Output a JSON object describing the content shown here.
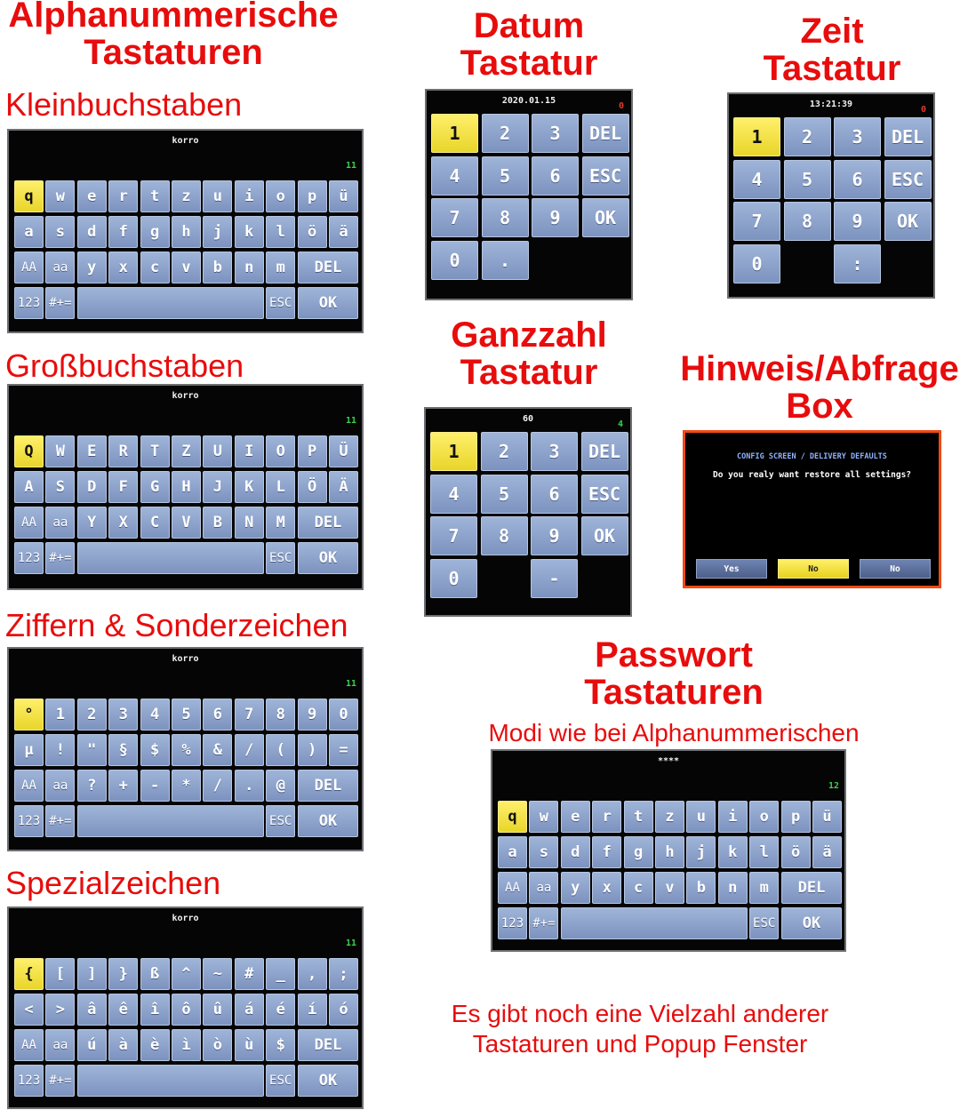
{
  "colors": {
    "heading": "#e80c0c",
    "key": "#8ea4cc",
    "key_selected": "#f2e23f",
    "screen": "#050505",
    "counter": "#39d34a",
    "counter_red": "#e63a2e",
    "dialog_border": "#f04a14"
  },
  "headings": {
    "alpha_line1": "Alphanummerische",
    "alpha_line2": "Tastaturen",
    "datum_line1": "Datum",
    "datum_line2": "Tastatur",
    "zeit_line1": "Zeit",
    "zeit_line2": "Tastatur",
    "ganz_line1": "Ganzzahl",
    "ganz_line2": "Tastatur",
    "hinweis_line1": "Hinweis/Abfrage",
    "hinweis_line2": "Box",
    "pass_line1": "Passwort",
    "pass_line2": "Tastaturen",
    "pass_sub": "Modi wie bei Alphanummerischen"
  },
  "labels": {
    "lower": "Kleinbuchstaben",
    "upper": "Großbuchstaben",
    "digits": "Ziffern & Sonderzeichen",
    "special": "Spezialzeichen"
  },
  "note": {
    "line1": "Es gibt noch eine Vielzahl anderer",
    "line2": "Tastaturen und Popup Fenster"
  },
  "keyboards": {
    "lower": {
      "field": "korro",
      "count": "11",
      "row1": [
        "q",
        "w",
        "e",
        "r",
        "t",
        "z",
        "u",
        "i",
        "o",
        "p",
        "ü"
      ],
      "row2": [
        "a",
        "s",
        "d",
        "f",
        "g",
        "h",
        "j",
        "k",
        "l",
        "ö",
        "ä"
      ],
      "row3": [
        "AA",
        "aa",
        "y",
        "x",
        "c",
        "v",
        "b",
        "n",
        "m",
        "DEL"
      ],
      "row4": [
        "123",
        "#+=",
        "",
        "ESC",
        "OK"
      ]
    },
    "upper": {
      "field": "korro",
      "count": "11",
      "row1": [
        "Q",
        "W",
        "E",
        "R",
        "T",
        "Z",
        "U",
        "I",
        "O",
        "P",
        "Ü"
      ],
      "row2": [
        "A",
        "S",
        "D",
        "F",
        "G",
        "H",
        "J",
        "K",
        "L",
        "Ö",
        "Ä"
      ],
      "row3": [
        "AA",
        "aa",
        "Y",
        "X",
        "C",
        "V",
        "B",
        "N",
        "M",
        "DEL"
      ],
      "row4": [
        "123",
        "#+=",
        "",
        "ESC",
        "OK"
      ]
    },
    "digits": {
      "field": "korro",
      "count": "11",
      "row1": [
        "°",
        "1",
        "2",
        "3",
        "4",
        "5",
        "6",
        "7",
        "8",
        "9",
        "0"
      ],
      "row2": [
        "µ",
        "!",
        "\"",
        "§",
        "$",
        "%",
        "&",
        "/",
        "(",
        ")",
        "="
      ],
      "row3": [
        "AA",
        "aa",
        "?",
        "+",
        "-",
        "*",
        "/",
        ".",
        "@",
        "DEL"
      ],
      "row4": [
        "123",
        "#+=",
        "",
        "ESC",
        "OK"
      ]
    },
    "special": {
      "field": "korro",
      "count": "11",
      "row1": [
        "{",
        "[",
        "]",
        "}",
        "ß",
        "^",
        "~",
        "#",
        "_",
        ",",
        ";"
      ],
      "row2": [
        "<",
        ">",
        "â",
        "ê",
        "î",
        "ô",
        "û",
        "á",
        "é",
        "í",
        "ó"
      ],
      "row3": [
        "AA",
        "aa",
        "ú",
        "à",
        "è",
        "ì",
        "ò",
        "ù",
        "$",
        "DEL"
      ],
      "row4": [
        "123",
        "#+=",
        "",
        "ESC",
        "OK"
      ]
    },
    "password": {
      "field": "****",
      "count": "12",
      "row1": [
        "q",
        "w",
        "e",
        "r",
        "t",
        "z",
        "u",
        "i",
        "o",
        "p",
        "ü"
      ],
      "row2": [
        "a",
        "s",
        "d",
        "f",
        "g",
        "h",
        "j",
        "k",
        "l",
        "ö",
        "ä"
      ],
      "row3": [
        "AA",
        "aa",
        "y",
        "x",
        "c",
        "v",
        "b",
        "n",
        "m",
        "DEL"
      ],
      "row4": [
        "123",
        "#+=",
        "",
        "ESC",
        "OK"
      ]
    }
  },
  "numpads": {
    "datum": {
      "field": "2020.01.15",
      "count": "0",
      "rows": [
        [
          "1",
          "2",
          "3",
          "DEL"
        ],
        [
          "4",
          "5",
          "6",
          "ESC"
        ],
        [
          "7",
          "8",
          "9",
          "OK"
        ],
        [
          "0",
          ".",
          "",
          ""
        ]
      ]
    },
    "zeit": {
      "field": "13:21:39",
      "count": "0",
      "rows": [
        [
          "1",
          "2",
          "3",
          "DEL"
        ],
        [
          "4",
          "5",
          "6",
          "ESC"
        ],
        [
          "7",
          "8",
          "9",
          "OK"
        ],
        [
          "0",
          "",
          ":",
          ""
        ]
      ]
    },
    "ganz": {
      "field": "60",
      "count": "4",
      "rows": [
        [
          "1",
          "2",
          "3",
          "DEL"
        ],
        [
          "4",
          "5",
          "6",
          "ESC"
        ],
        [
          "7",
          "8",
          "9",
          "OK"
        ],
        [
          "0",
          "",
          "-",
          ""
        ]
      ]
    }
  },
  "dialog": {
    "title": "CONFIG SCREEN / DELIVERY DEFAULTS",
    "message": "Do you realy want restore all settings?",
    "buttons": [
      "Yes",
      "No",
      "No"
    ]
  }
}
